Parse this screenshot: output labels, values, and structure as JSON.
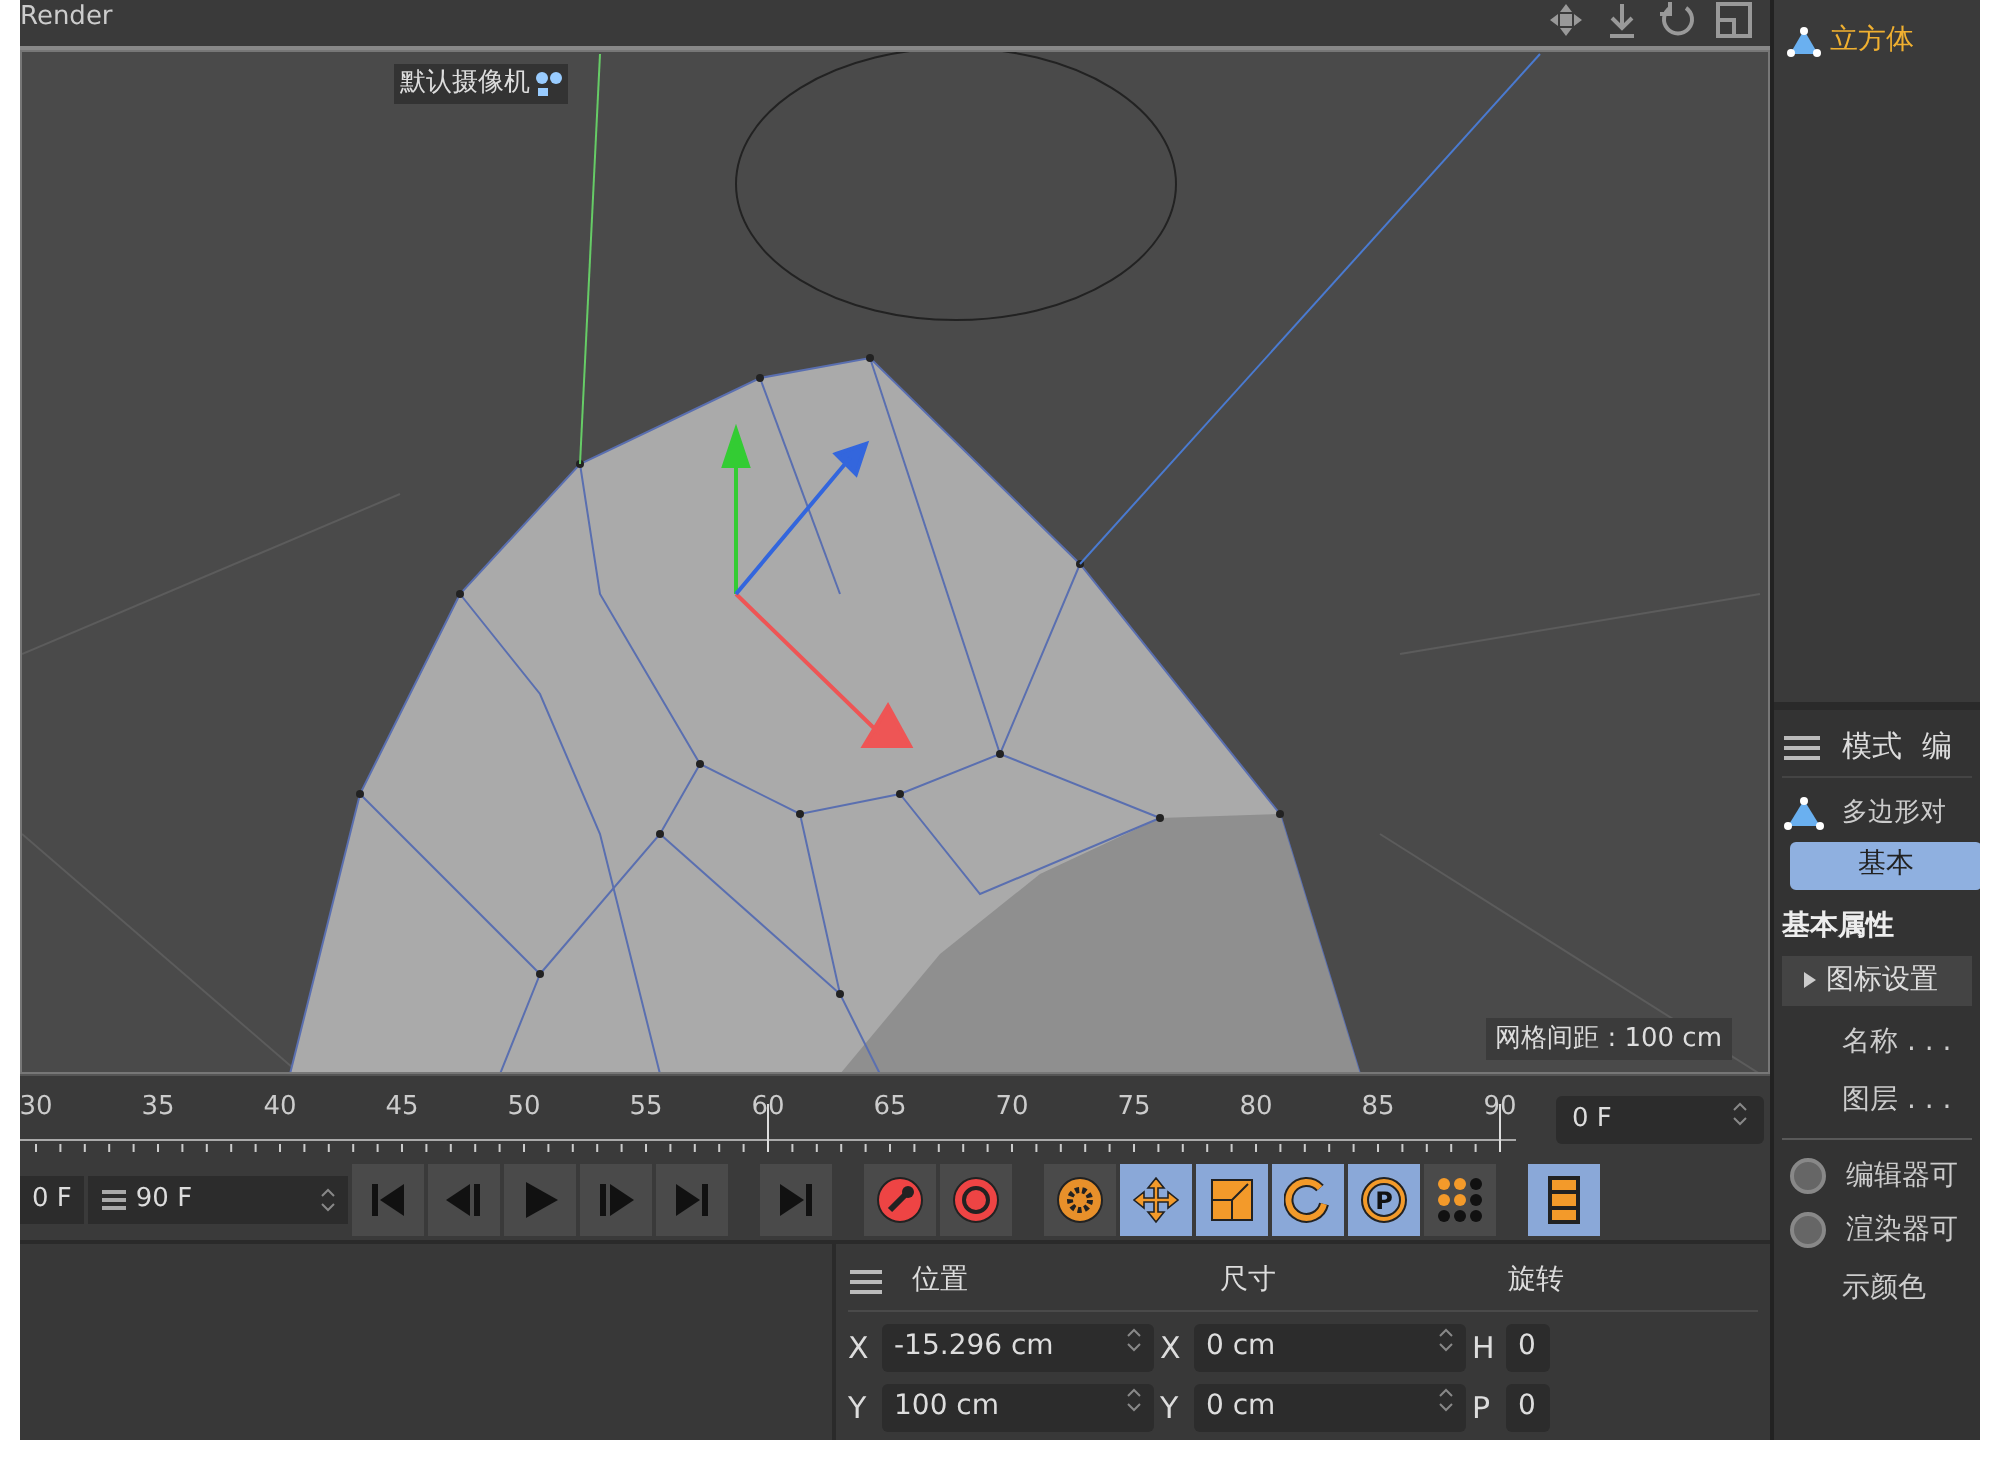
{
  "viewport": {
    "menu_fragment": "Render",
    "camera_label": "默认摄像机",
    "grid_spacing": "网格间距 : 100 cm"
  },
  "object_manager": {
    "items": [
      {
        "label": "立方体",
        "selected": true
      }
    ]
  },
  "attributes": {
    "menu": [
      "模式",
      "编"
    ],
    "object_type": "多边形对",
    "tabs": [
      {
        "label": "基本",
        "selected": true
      }
    ],
    "heading": "基本属性",
    "group": {
      "label": "图标设置",
      "expanded": false
    },
    "fields": [
      "名称 . . .",
      "图层 . . ."
    ],
    "radios": [
      {
        "label": "编辑器可",
        "checked": false
      },
      {
        "label": "渲染器可",
        "checked": false
      }
    ],
    "extra": "示颜色"
  },
  "timeline": {
    "ticks": [
      "30",
      "35",
      "40",
      "45",
      "50",
      "55",
      "60",
      "65",
      "70",
      "75",
      "80",
      "85",
      "90"
    ],
    "current_frame": "0 F",
    "start_field": "0 F",
    "end_field": "90 F",
    "buttons": [
      {
        "kind": "first",
        "on": false
      },
      {
        "kind": "prev_key",
        "on": false
      },
      {
        "kind": "play",
        "on": false
      },
      {
        "kind": "next_key",
        "on": false
      },
      {
        "kind": "last",
        "on": false
      },
      {
        "kind": "end",
        "on": false
      },
      {
        "kind": "record",
        "on": false
      },
      {
        "kind": "autokey",
        "on": false
      },
      {
        "kind": "gear",
        "on": false
      },
      {
        "kind": "move",
        "on": true
      },
      {
        "kind": "scale",
        "on": true
      },
      {
        "kind": "rotate",
        "on": true
      },
      {
        "kind": "param",
        "on": true,
        "label": "P"
      },
      {
        "kind": "dots",
        "on": false
      },
      {
        "kind": "film",
        "on": true
      }
    ]
  },
  "coordinates": {
    "headers": [
      "位置",
      "尺寸",
      "旋转"
    ],
    "rows": [
      {
        "axis": "X",
        "position": "-15.296 cm",
        "size_axis": "X",
        "size": "0 cm",
        "rot_axis": "H",
        "rotation": "0"
      },
      {
        "axis": "Y",
        "position": "100 cm",
        "size_axis": "Y",
        "size": "0 cm",
        "rot_axis": "P",
        "rotation": "0"
      }
    ]
  }
}
